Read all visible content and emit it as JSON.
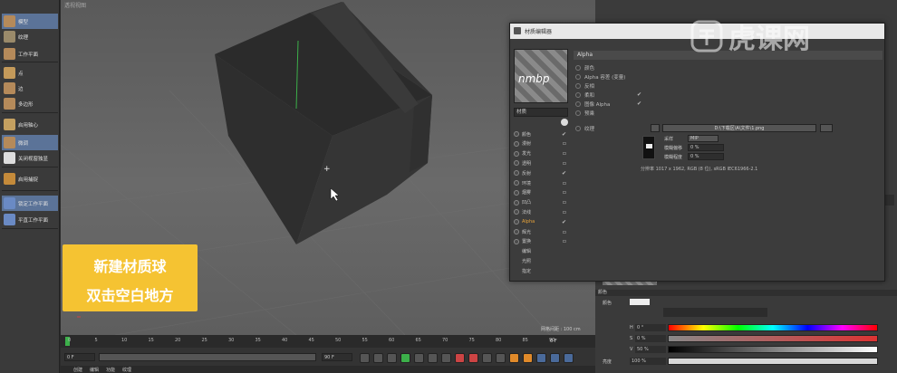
{
  "left_toolbar": {
    "items": [
      {
        "label": "模型",
        "icon": "cube-icon",
        "active": true
      },
      {
        "label": "纹理",
        "icon": "checker-icon",
        "active": false
      },
      {
        "label": "工作平面",
        "icon": "plane-icon",
        "active": false
      },
      {
        "label": "点",
        "icon": "point-icon",
        "active": false
      },
      {
        "label": "边",
        "icon": "edge-icon",
        "active": false
      },
      {
        "label": "多边形",
        "icon": "polygon-icon",
        "active": false
      },
      {
        "label": "启用轴心",
        "icon": "axis-icon",
        "active": false
      },
      {
        "label": "微调",
        "icon": "tweak-icon",
        "active": true
      },
      {
        "label": "关闭视窗独显",
        "icon": "solo-icon",
        "active": false
      },
      {
        "label": "启用捕捉",
        "icon": "snap-icon",
        "active": false
      },
      {
        "label": "锁定工作平面",
        "icon": "lock-plane-icon",
        "active": true
      },
      {
        "label": "平直工作平面",
        "icon": "flat-plane-icon",
        "active": false
      }
    ]
  },
  "viewport": {
    "title": "透视视图",
    "grid_label": "网格间距 : 100 cm"
  },
  "material_editor": {
    "title": "材质编辑器",
    "material_name": "材质",
    "channels": [
      {
        "label": "颜色",
        "checked": true
      },
      {
        "label": "漫射",
        "checked": false
      },
      {
        "label": "发光",
        "checked": false
      },
      {
        "label": "透明",
        "checked": false
      },
      {
        "label": "反射",
        "checked": true
      },
      {
        "label": "环境",
        "checked": false
      },
      {
        "label": "烟雾",
        "checked": false
      },
      {
        "label": "凹凸",
        "checked": false
      },
      {
        "label": "法线",
        "checked": false
      },
      {
        "label": "Alpha",
        "checked": true,
        "active": true
      },
      {
        "label": "辉光",
        "checked": false
      },
      {
        "label": "置换",
        "checked": false
      },
      {
        "label": "编辑",
        "checked": false
      },
      {
        "label": "光照",
        "checked": false
      },
      {
        "label": "指定",
        "checked": false
      }
    ],
    "section_title": "Alpha",
    "properties": [
      {
        "label": "颜色",
        "value": ""
      },
      {
        "label": "Alpha 容差 (变量)",
        "value": ""
      },
      {
        "label": "反相",
        "value": ""
      },
      {
        "label": "柔和",
        "value": "✔"
      },
      {
        "label": "图像 Alpha",
        "value": "✔"
      },
      {
        "label": "预乘",
        "value": ""
      }
    ],
    "texture_label": "纹理",
    "texture_path": "D:\\下载区\\A\\文件\\1.png",
    "sampling_label": "采样",
    "sampling_value": "MIP",
    "blur_offset_label": "模糊偏移",
    "blur_offset_value": "0 %",
    "blur_degree_label": "模糊程度",
    "blur_degree_value": "0 %",
    "resolution_text": "分辨率 1017 x 1962, RGB (8 位), sRGB IEC61966-2.1"
  },
  "color_panel": {
    "title": "颜色",
    "mode_label": "颜色",
    "h_label": "H",
    "h_value": "0 °",
    "s_label": "S",
    "s_value": "0 %",
    "v_label": "V",
    "v_value": "50 %",
    "brightness_label": "亮度",
    "brightness_value": "100 %"
  },
  "timeline": {
    "ticks": [
      "0",
      "5",
      "10",
      "15",
      "20",
      "25",
      "30",
      "35",
      "40",
      "45",
      "50",
      "55",
      "60",
      "65",
      "70",
      "75",
      "80",
      "85",
      "90"
    ],
    "frame_start": "0 F",
    "frame_current": "0 F",
    "frame_end": "90 F",
    "frame_end2": "90 F",
    "current_frame_marker": "0 F"
  },
  "bottom_menu": {
    "items": [
      "创建",
      "编辑",
      "功能",
      "纹理"
    ]
  },
  "caption": {
    "line1": "新建材质球",
    "line2": "双击空白地方"
  },
  "watermark": {
    "text": "虎课网"
  },
  "colors": {
    "accent_blue": "#5b7398",
    "caption_yellow": "#f5c332",
    "alpha_orange": "#e8a33a"
  }
}
